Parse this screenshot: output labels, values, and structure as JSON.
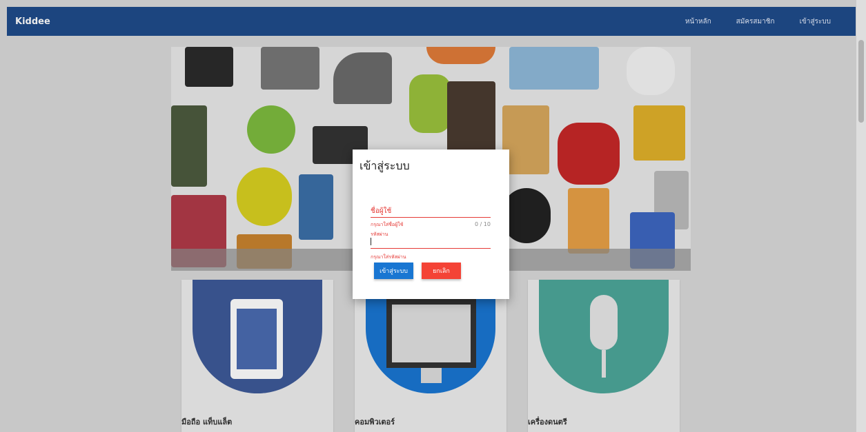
{
  "app": {
    "brand": "Kiddee"
  },
  "nav": {
    "home": "หน้าหลัก",
    "register": "สมัครสมาชิก",
    "login": "เข้าสู่ระบบ"
  },
  "cards": [
    {
      "title": "มือถือ แท็บแล็ต",
      "color": "#3d5a98"
    },
    {
      "title": "คอมพิวเตอร์",
      "color": "#1976d2"
    },
    {
      "title": "เครื่องดนตรี",
      "color": "#4ca79a"
    }
  ],
  "dialog": {
    "title": "เข้าสู่ระบบ",
    "username_label": "ชื่อผู้ใช้",
    "username_hint": "กรุณาใส่ชื่อผู้ใช้",
    "username_counter": "0 / 10",
    "password_label": "รหัสผ่าน",
    "password_hint": "กรุณาใส่รหัสผ่าน",
    "submit": "เข้าสู่ระบบ",
    "cancel": "ยกเลิก"
  },
  "colors": {
    "appbar": "#1f4b8a",
    "error": "#e53935",
    "primary_button": "#1976d2",
    "cancel_button": "#f44336"
  }
}
